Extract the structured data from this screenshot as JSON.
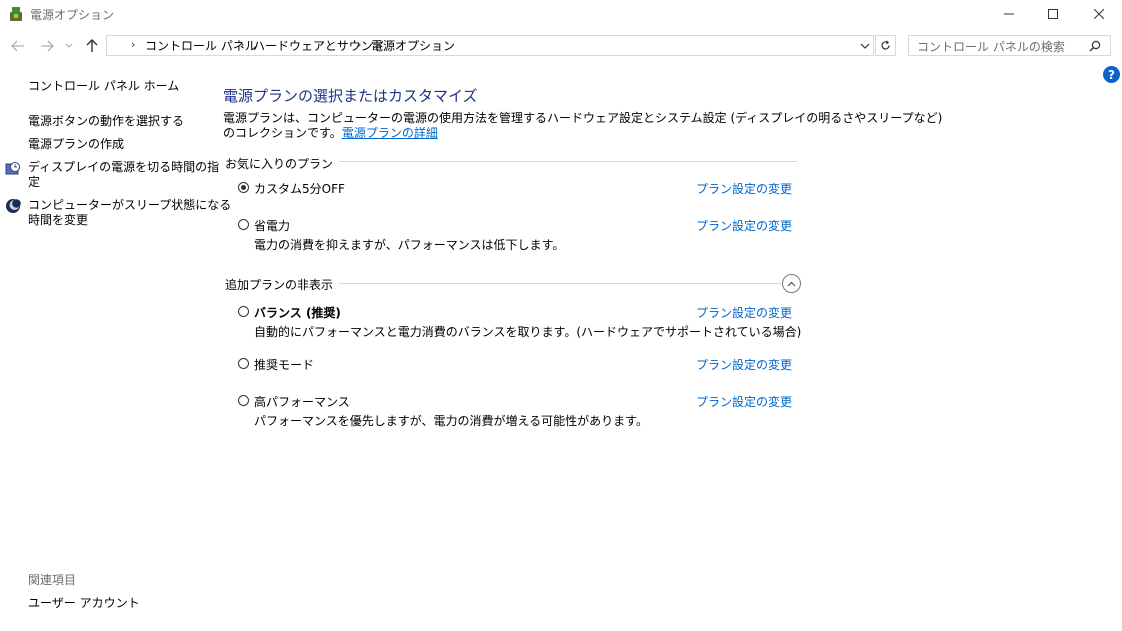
{
  "window": {
    "title": "電源オプション"
  },
  "breadcrumb": [
    "コントロール パネル",
    "ハードウェアとサウンド",
    "電源オプション"
  ],
  "search": {
    "placeholder": "コントロール パネルの検索"
  },
  "sidebar": {
    "home": "コントロール パネル ホーム",
    "links": [
      "電源ボタンの動作を選択する",
      "電源プランの作成",
      "ディスプレイの電源を切る時間の指\n定",
      "コンピューターがスリープ状態になる\n時間を変更"
    ],
    "related_heading": "関連項目",
    "related_links": [
      "ユーザー アカウント"
    ]
  },
  "main": {
    "title": "電源プランの選択またはカスタマイズ",
    "description_line1": "電源プランは、コンピューターの電源の使用方法を管理するハードウェア設定とシステム設定 (ディスプレイの明るさやスリープなど)",
    "description_line2": "のコレクションです。",
    "description_link": "電源プランの詳細",
    "favorites_heading": "お気に入りのプラン",
    "hidden_heading": "追加プランの非表示",
    "change_link": "プラン設定の変更",
    "favorite_plans": [
      {
        "name": "カスタム5分OFF",
        "desc": "",
        "selected": true
      },
      {
        "name": "省電力",
        "desc": "電力の消費を抑えますが、パフォーマンスは低下します。",
        "selected": false
      }
    ],
    "hidden_plans": [
      {
        "name": "バランス (推奨)",
        "desc": "自動的にパフォーマンスと電力消費のバランスを取ります。(ハードウェアでサポートされている場合)",
        "selected": false,
        "bold": true
      },
      {
        "name": "推奨モード",
        "desc": "",
        "selected": false
      },
      {
        "name": "高パフォーマンス",
        "desc": "パフォーマンスを優先しますが、電力の消費が増える可能性があります。",
        "selected": false
      }
    ]
  },
  "colors": {
    "title": "#1e3287",
    "link": "#0066cc",
    "help": "#0a64c8"
  }
}
